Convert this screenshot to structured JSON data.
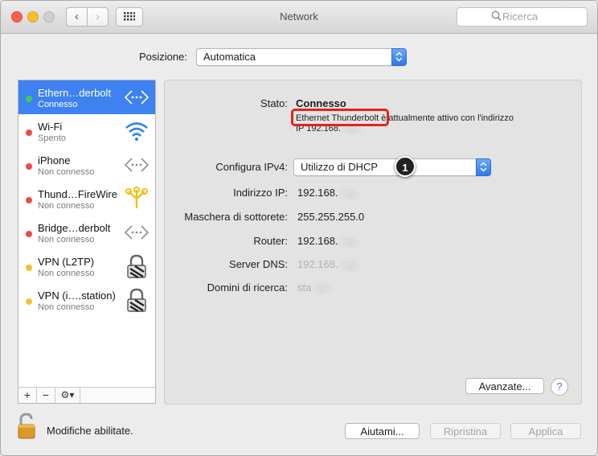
{
  "window": {
    "title": "Network"
  },
  "search": {
    "placeholder": "Ricerca"
  },
  "location": {
    "label": "Posizione:",
    "value": "Automatica"
  },
  "services": [
    {
      "name": "Ethern…derbolt",
      "status": "Connesso",
      "dot": "#3ccf4e",
      "icon": "ethernet-arrows-icon",
      "selected": true
    },
    {
      "name": "Wi-Fi",
      "status": "Spento",
      "dot": "#ee4b43",
      "icon": "wifi-icon"
    },
    {
      "name": "iPhone",
      "status": "Non connesso",
      "dot": "#ee4b43",
      "icon": "ethernet-arrows-icon"
    },
    {
      "name": "Thund…FireWire",
      "status": "Non connesso",
      "dot": "#ee4b43",
      "icon": "firewire-icon"
    },
    {
      "name": "Bridge…derbolt",
      "status": "Non connesso",
      "dot": "#ee4b43",
      "icon": "ethernet-arrows-icon"
    },
    {
      "name": "VPN (L2TP)",
      "status": "Non connesso",
      "dot": "#f5c22b",
      "icon": "vpn-lock-icon"
    },
    {
      "name": "VPN (i….station)",
      "status": "Non connesso",
      "dot": "#f5c22b",
      "icon": "vpn-lock-icon"
    }
  ],
  "sidebar_tools": {
    "add": "+",
    "remove": "−",
    "action": "⚙▾"
  },
  "details": {
    "status_label": "Stato:",
    "status_value": "Connesso",
    "status_desc_highlight": "Ethernet Thunderbolt",
    "status_desc_rest": "è attualmente attivo con l'indirizzo",
    "status_desc_ip": "IP 192.168.",
    "ipv4_label": "Configura IPv4:",
    "ipv4_value": "Utilizzo di DHCP",
    "ip_label": "Indirizzo IP:",
    "ip_value": "192.168.",
    "mask_label": "Maschera di sottorete:",
    "mask_value": "255.255.255.0",
    "router_label": "Router:",
    "router_value": "192.168.",
    "dns_label": "Server DNS:",
    "dns_value": "192.168.",
    "domains_label": "Domini di ricerca:",
    "domains_value": "sta",
    "advanced_button": "Avanzate...",
    "help_button": "?"
  },
  "annotation": {
    "badge": "1",
    "highlight_color": "#e0241b"
  },
  "footer": {
    "lock_text": "Modifiche abilitate.",
    "help_button": "Aiutami...",
    "revert_button": "Ripristina",
    "apply_button": "Applica"
  },
  "colors": {
    "selection": "#3d82f0",
    "accent": "#2f78e9"
  }
}
